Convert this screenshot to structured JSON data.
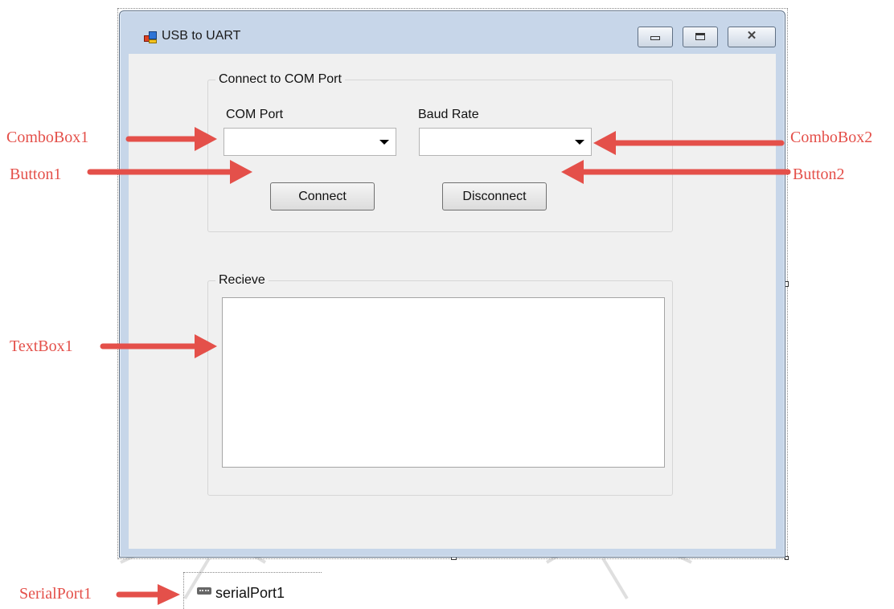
{
  "window": {
    "title": "USB to UART",
    "controls": [
      "minimize",
      "maximize",
      "close"
    ]
  },
  "groups": {
    "connect": {
      "title": "Connect to COM Port",
      "com_port_label": "COM Port",
      "baud_rate_label": "Baud Rate",
      "com_port_value": "",
      "baud_rate_value": "",
      "connect_label": "Connect",
      "disconnect_label": "Disconnect"
    },
    "receive": {
      "title": "Recieve",
      "text": ""
    }
  },
  "tray": {
    "component_label": "serialPort1"
  },
  "callouts": {
    "combobox1": "ComboBox1",
    "combobox2": "ComboBox2",
    "button1": "Button1",
    "button2": "Button2",
    "textbox1": "TextBox1",
    "serialport1": "SerialPort1"
  },
  "colors": {
    "callout": "#e4504a",
    "window_frame": "#c7d6e9",
    "client_bg": "#f0f0f0"
  },
  "icons": {
    "app": "windows-forms-app-icon",
    "serial": "serial-port-component-icon"
  }
}
